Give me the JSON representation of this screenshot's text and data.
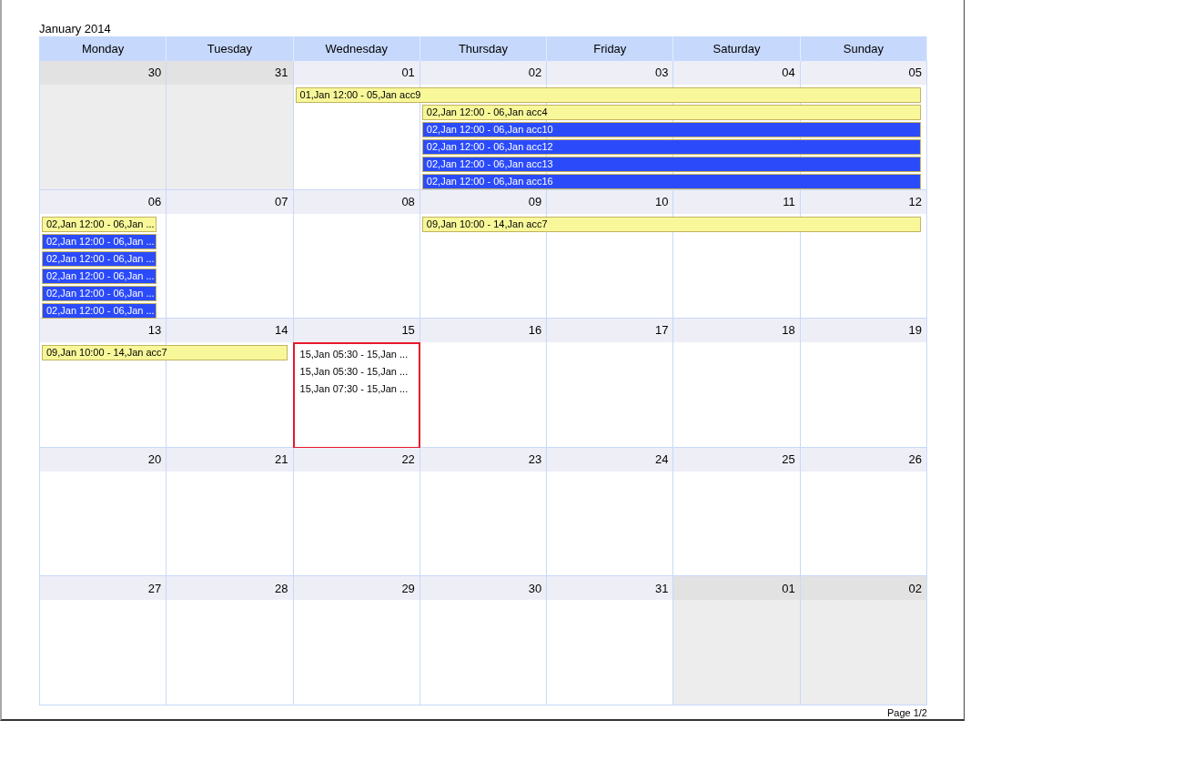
{
  "title": "January 2014",
  "weekdays": [
    "Monday",
    "Tuesday",
    "Wednesday",
    "Thursday",
    "Friday",
    "Saturday",
    "Sunday"
  ],
  "weeks": [
    {
      "days": [
        {
          "number": "30",
          "other_month": true,
          "selected": false
        },
        {
          "number": "31",
          "other_month": true,
          "selected": false
        },
        {
          "number": "01",
          "other_month": false,
          "selected": false,
          "entries": [
            {
              "kind": "bar",
              "text": "01,Jan 12:00 - 05,Jan acc9",
              "color": "#f8f89a"
            }
          ]
        },
        {
          "number": "02",
          "other_month": false,
          "selected": false,
          "entries": [
            {
              "kind": "continued"
            },
            {
              "kind": "bar",
              "text": "02,Jan 12:00 - 06,Jan acc4",
              "color": "#f8f89a"
            },
            {
              "kind": "bar",
              "text": "02,Jan 12:00 - 06,Jan acc10",
              "color": "#2b4bfb"
            },
            {
              "kind": "bar",
              "text": "02,Jan 12:00 - 06,Jan acc12",
              "color": "#2b4bfb"
            },
            {
              "kind": "bar",
              "text": "02,Jan 12:00 - 06,Jan acc13",
              "color": "#2b4bfb"
            },
            {
              "kind": "bar",
              "text": "02,Jan 12:00 - 06,Jan acc16",
              "color": "#2b4bfb"
            }
          ]
        },
        {
          "number": "03",
          "other_month": false,
          "selected": false,
          "entries": [
            {
              "kind": "continued"
            },
            {
              "kind": "continued"
            },
            {
              "kind": "continued"
            },
            {
              "kind": "continued"
            },
            {
              "kind": "continued"
            },
            {
              "kind": "continued"
            }
          ]
        },
        {
          "number": "04",
          "other_month": false,
          "selected": false,
          "entries": [
            {
              "kind": "continued"
            },
            {
              "kind": "continued"
            },
            {
              "kind": "continued"
            },
            {
              "kind": "continued"
            },
            {
              "kind": "continued"
            },
            {
              "kind": "continued"
            }
          ]
        },
        {
          "number": "05",
          "other_month": false,
          "selected": false,
          "entries": [
            {
              "kind": "continued"
            },
            {
              "kind": "continued"
            },
            {
              "kind": "continued"
            },
            {
              "kind": "continued"
            },
            {
              "kind": "continued"
            },
            {
              "kind": "continued"
            }
          ]
        }
      ]
    },
    {
      "days": [
        {
          "number": "06",
          "other_month": false,
          "selected": false,
          "entries": [
            {
              "kind": "bar",
              "text": "02,Jan 12:00 - 06,Jan ...",
              "color": "#f8f89a"
            },
            {
              "kind": "bar",
              "text": "02,Jan 12:00 - 06,Jan ...",
              "color": "#2b4bfb"
            },
            {
              "kind": "bar",
              "text": "02,Jan 12:00 - 06,Jan ...",
              "color": "#2b4bfb"
            },
            {
              "kind": "bar",
              "text": "02,Jan 12:00 - 06,Jan ...",
              "color": "#2b4bfb"
            },
            {
              "kind": "bar",
              "text": "02,Jan 12:00 - 06,Jan ...",
              "color": "#2b4bfb"
            },
            {
              "kind": "bar",
              "text": "02,Jan 12:00 - 06,Jan ...",
              "color": "#2b4bfb"
            }
          ]
        },
        {
          "number": "07",
          "other_month": false,
          "selected": false
        },
        {
          "number": "08",
          "other_month": false,
          "selected": false
        },
        {
          "number": "09",
          "other_month": false,
          "selected": false,
          "entries": [
            {
              "kind": "bar",
              "text": "09,Jan 10:00 - 14,Jan acc7",
              "color": "#f8f89a"
            }
          ]
        },
        {
          "number": "10",
          "other_month": false,
          "selected": false,
          "entries": [
            {
              "kind": "continued"
            }
          ]
        },
        {
          "number": "11",
          "other_month": false,
          "selected": false,
          "entries": [
            {
              "kind": "continued"
            }
          ]
        },
        {
          "number": "12",
          "other_month": false,
          "selected": false,
          "entries": [
            {
              "kind": "continued"
            }
          ]
        }
      ]
    },
    {
      "days": [
        {
          "number": "13",
          "other_month": false,
          "selected": false,
          "entries": [
            {
              "kind": "bar",
              "text": "09,Jan 10:00 - 14,Jan acc7",
              "color": "#f8f89a"
            }
          ]
        },
        {
          "number": "14",
          "other_month": false,
          "selected": false,
          "entries": [
            {
              "kind": "continued"
            }
          ]
        },
        {
          "number": "15",
          "other_month": false,
          "selected": true,
          "entries": [
            {
              "kind": "text",
              "text": "15,Jan 05:30 - 15,Jan ..."
            },
            {
              "kind": "text",
              "text": "15,Jan 05:30 - 15,Jan ..."
            },
            {
              "kind": "text",
              "text": "15,Jan 07:30 - 15,Jan ..."
            }
          ]
        },
        {
          "number": "16",
          "other_month": false,
          "selected": false
        },
        {
          "number": "17",
          "other_month": false,
          "selected": false
        },
        {
          "number": "18",
          "other_month": false,
          "selected": false
        },
        {
          "number": "19",
          "other_month": false,
          "selected": false
        }
      ]
    },
    {
      "days": [
        {
          "number": "20",
          "other_month": false,
          "selected": false
        },
        {
          "number": "21",
          "other_month": false,
          "selected": false
        },
        {
          "number": "22",
          "other_month": false,
          "selected": false
        },
        {
          "number": "23",
          "other_month": false,
          "selected": false
        },
        {
          "number": "24",
          "other_month": false,
          "selected": false
        },
        {
          "number": "25",
          "other_month": false,
          "selected": false
        },
        {
          "number": "26",
          "other_month": false,
          "selected": false
        }
      ]
    },
    {
      "days": [
        {
          "number": "27",
          "other_month": false,
          "selected": false
        },
        {
          "number": "28",
          "other_month": false,
          "selected": false
        },
        {
          "number": "29",
          "other_month": false,
          "selected": false
        },
        {
          "number": "30",
          "other_month": false,
          "selected": false
        },
        {
          "number": "31",
          "other_month": false,
          "selected": false
        },
        {
          "number": "01",
          "other_month": true,
          "selected": false
        },
        {
          "number": "02",
          "other_month": true,
          "selected": false
        }
      ]
    }
  ],
  "footer": "Page 1/2"
}
